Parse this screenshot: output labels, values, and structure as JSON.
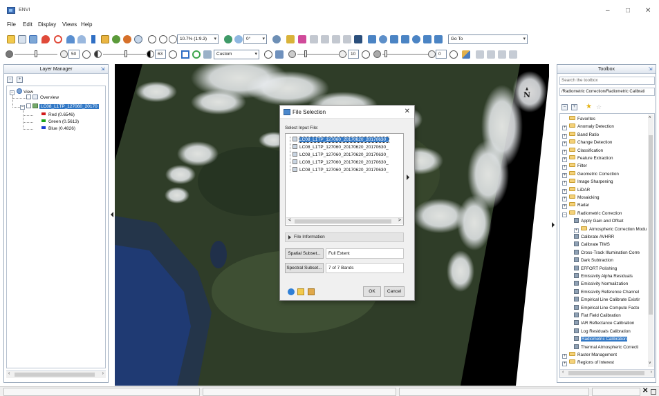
{
  "window": {
    "title": "ENVI",
    "minimize": "–",
    "maximize": "□",
    "close": "✕"
  },
  "menu": [
    "File",
    "Edit",
    "Display",
    "Views",
    "Help"
  ],
  "toolbar1": {
    "zoom_value": "10.7% (1:9.3)",
    "rotation_value": "0°",
    "goto_value": "Go To"
  },
  "toolbar2": {
    "brightness": "50",
    "contrast": "63",
    "stretch": "Custom",
    "sharpen": "10",
    "transparency": "0"
  },
  "layer_manager": {
    "title": "Layer Manager",
    "collapse_all": "–",
    "expand_all": "+",
    "tree": {
      "view": "View",
      "overview": "Overview",
      "layer": "LC08_L1TP_127060_20170",
      "bands": [
        {
          "label": "Red (0.6546)",
          "color": "#d11a1a"
        },
        {
          "label": "Green (0.5613)",
          "color": "#1aa31a"
        },
        {
          "label": "Blue (0.4826)",
          "color": "#1a3fd1"
        }
      ]
    }
  },
  "file_dialog": {
    "title": "File Selection",
    "close": "✕",
    "input_label": "Select Input File:",
    "files": [
      "LC08_L1TP_127060_20170620_20170630_",
      "LC08_L1TP_127060_20170620_20170630_",
      "LC08_L1TP_127060_20170620_20170630_",
      "LC08_L1TP_127060_20170620_20170630_",
      "LC08_L1TP_127060_20170620_20170630_"
    ],
    "scroll_left": "<",
    "scroll_right": ">",
    "file_info": "File Information",
    "spatial_button": "Spatial Subset...",
    "spatial_value": "Full Extent",
    "spectral_button": "Spectral Subset...",
    "spectral_value": "7 of 7 Bands",
    "ok": "OK",
    "cancel": "Cancel"
  },
  "map": {
    "north": "N"
  },
  "toolbox": {
    "title": "Toolbox",
    "search_placeholder": "Search the toolbox",
    "path": "/Radiometric Correction/Radiometric Calibrati",
    "items": [
      {
        "label": "Favorites",
        "kind": "folder",
        "level": 0,
        "expander": ""
      },
      {
        "label": "Anomaly Detection",
        "kind": "folder",
        "level": 0,
        "expander": "+"
      },
      {
        "label": "Band Ratio",
        "kind": "folder",
        "level": 0,
        "expander": "+"
      },
      {
        "label": "Change Detection",
        "kind": "folder",
        "level": 0,
        "expander": "+"
      },
      {
        "label": "Classification",
        "kind": "folder",
        "level": 0,
        "expander": "+"
      },
      {
        "label": "Feature Extraction",
        "kind": "folder",
        "level": 0,
        "expander": "+"
      },
      {
        "label": "Filter",
        "kind": "folder",
        "level": 0,
        "expander": "+"
      },
      {
        "label": "Geometric Correction",
        "kind": "folder",
        "level": 0,
        "expander": "+"
      },
      {
        "label": "Image Sharpening",
        "kind": "folder",
        "level": 0,
        "expander": "+"
      },
      {
        "label": "LiDAR",
        "kind": "folder",
        "level": 0,
        "expander": "+"
      },
      {
        "label": "Mosaicking",
        "kind": "folder",
        "level": 0,
        "expander": "+"
      },
      {
        "label": "Radar",
        "kind": "folder",
        "level": 0,
        "expander": "+"
      },
      {
        "label": "Radiometric Correction",
        "kind": "folder",
        "level": 0,
        "expander": "–"
      },
      {
        "label": "Apply Gain and Offset",
        "kind": "tool",
        "level": 1,
        "expander": ""
      },
      {
        "label": "Atmospheric Correction Modu",
        "kind": "folder",
        "level": 1,
        "expander": "+"
      },
      {
        "label": "Calibrate AVHRR",
        "kind": "tool",
        "level": 1,
        "expander": ""
      },
      {
        "label": "Calibrate TIMS",
        "kind": "tool",
        "level": 1,
        "expander": ""
      },
      {
        "label": "Cross-Track Illumination Corre",
        "kind": "tool",
        "level": 1,
        "expander": ""
      },
      {
        "label": "Dark Subtraction",
        "kind": "tool",
        "level": 1,
        "expander": ""
      },
      {
        "label": "EFFORT Polishing",
        "kind": "tool",
        "level": 1,
        "expander": ""
      },
      {
        "label": "Emissivity Alpha Residuals",
        "kind": "tool",
        "level": 1,
        "expander": ""
      },
      {
        "label": "Emissivity Normalization",
        "kind": "tool",
        "level": 1,
        "expander": ""
      },
      {
        "label": "Emissivity Reference Channel",
        "kind": "tool",
        "level": 1,
        "expander": ""
      },
      {
        "label": "Empirical Line Calibrate Existir",
        "kind": "tool",
        "level": 1,
        "expander": ""
      },
      {
        "label": "Empirical Line Compute Facto",
        "kind": "tool",
        "level": 1,
        "expander": ""
      },
      {
        "label": "Flat Field Calibration",
        "kind": "tool",
        "level": 1,
        "expander": ""
      },
      {
        "label": "IAR Reflectance Calibration",
        "kind": "tool",
        "level": 1,
        "expander": ""
      },
      {
        "label": "Log Residuals Calibration",
        "kind": "tool",
        "level": 1,
        "expander": ""
      },
      {
        "label": "Radiometric Calibration",
        "kind": "tool",
        "level": 1,
        "expander": "",
        "selected": true
      },
      {
        "label": "Thermal Atmospheric Correcti",
        "kind": "tool",
        "level": 1,
        "expander": ""
      },
      {
        "label": "Raster Management",
        "kind": "folder",
        "level": 0,
        "expander": "+"
      },
      {
        "label": "Regions of Interest",
        "kind": "folder",
        "level": 0,
        "expander": "+"
      }
    ]
  },
  "colors": {
    "accent": "#3178c6",
    "folder": "#f4d17a",
    "panel_border": "#9aa9bb"
  }
}
